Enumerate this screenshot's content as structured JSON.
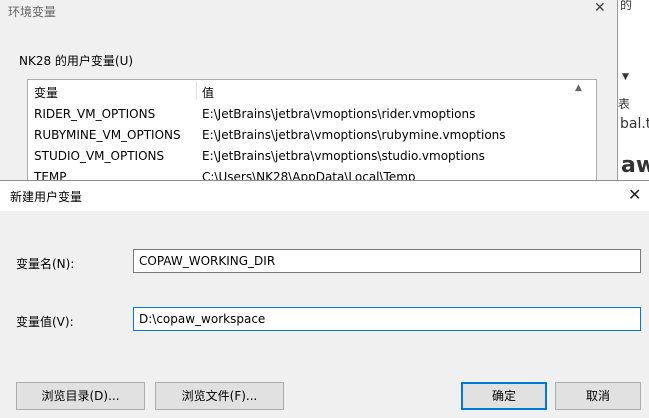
{
  "background_window": {
    "title": "环境变量",
    "close_glyph": "✕",
    "group_label": "NK28 的用户变量(U)",
    "columns": [
      "变量",
      "值"
    ],
    "rows": [
      {
        "name": "RIDER_VM_OPTIONS",
        "value": "E:\\JetBrains\\jetbra\\vmoptions\\rider.vmoptions"
      },
      {
        "name": "RUBYMINE_VM_OPTIONS",
        "value": "E:\\JetBrains\\jetbra\\vmoptions\\rubymine.vmoptions"
      },
      {
        "name": "STUDIO_VM_OPTIONS",
        "value": "E:\\JetBrains\\jetbra\\vmoptions\\studio.vmoptions"
      },
      {
        "name": "TEMP",
        "value": "C:\\Users\\NK28\\AppData\\Local\\Temp"
      }
    ]
  },
  "right_peek": {
    "t1": "的",
    "t2": "表",
    "t3": "bal.tr",
    "t4": "aw"
  },
  "dialog": {
    "title": "新建用户变量",
    "close_glyph": "✕",
    "var_name_label": "变量名(N):",
    "var_name_value": "COPAW_WORKING_DIR",
    "var_value_label": "变量值(V):",
    "var_value_value": "D:\\copaw_workspace",
    "browse_dir_label": "浏览目录(D)...",
    "browse_file_label": "浏览文件(F)...",
    "ok_label": "确定",
    "cancel_label": "取消"
  }
}
